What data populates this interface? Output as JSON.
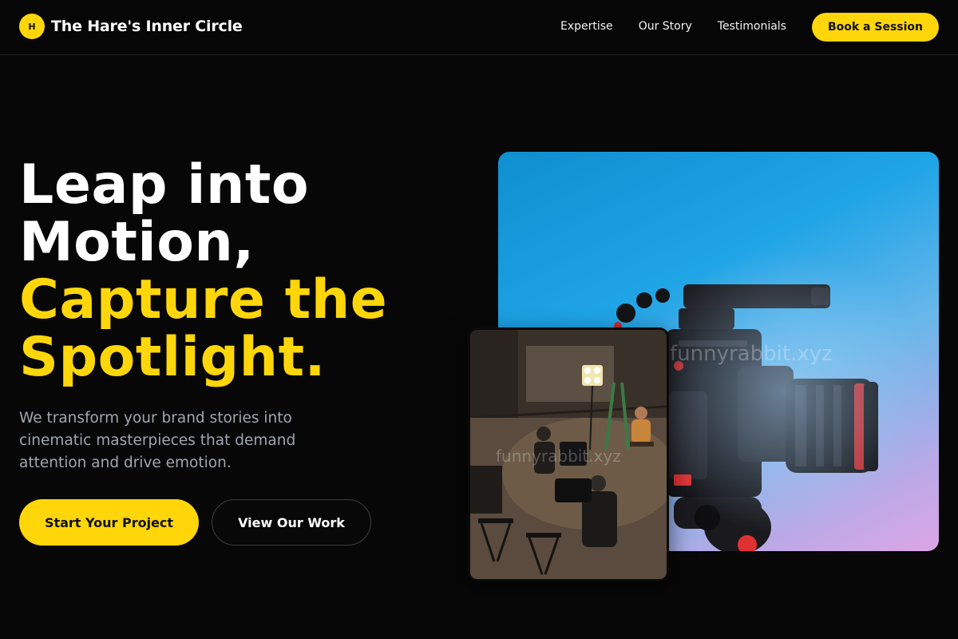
{
  "brand": {
    "badge": "H",
    "name": "The Hare's Inner Circle"
  },
  "nav": {
    "items": [
      {
        "label": "Expertise"
      },
      {
        "label": "Our Story"
      },
      {
        "label": "Testimonials"
      }
    ],
    "cta": "Book a Session"
  },
  "hero": {
    "headline_line1": "Leap into",
    "headline_line2": "Motion,",
    "headline_accent1": "Capture the",
    "headline_accent2": "Spotlight.",
    "subtext": "We transform your brand stories into cinematic masterpieces that demand attention and drive emotion.",
    "primary_cta": "Start Your Project",
    "secondary_cta": "View Our Work"
  },
  "media": {
    "watermark_main": "funnyrabbit.xyz",
    "watermark_inset": "funnyrabbit.xyz"
  },
  "colors": {
    "accent": "#ffd60a",
    "background": "#070707",
    "muted_text": "#a1a6b0"
  }
}
